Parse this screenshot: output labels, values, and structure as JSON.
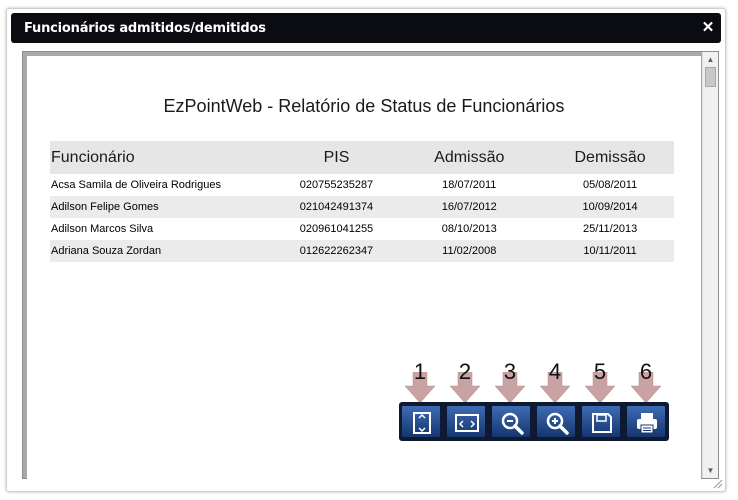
{
  "dialog": {
    "title": "Funcionários admitidos/demitidos",
    "close_glyph": "✕"
  },
  "report": {
    "title": "EzPointWeb - Relatório de Status de Funcionários",
    "columns": [
      "Funcionário",
      "PIS",
      "Admissão",
      "Demissão"
    ],
    "rows": [
      [
        "Acsa Samila de Oliveira Rodrigues",
        "020755235287",
        "18/07/2011",
        "05/08/2011"
      ],
      [
        "Adilson Felipe Gomes",
        "021042491374",
        "16/07/2012",
        "10/09/2014"
      ],
      [
        "Adilson Marcos Silva",
        "020961041255",
        "08/10/2013",
        "25/11/2013"
      ],
      [
        "Adriana Souza Zordan",
        "012622262347",
        "11/02/2008",
        "10/11/2011"
      ]
    ]
  },
  "callouts": [
    "1",
    "2",
    "3",
    "4",
    "5",
    "6"
  ],
  "toolbar": {
    "buttons": [
      {
        "icon": "fit-page-icon"
      },
      {
        "icon": "fit-width-icon"
      },
      {
        "icon": "zoom-out-icon"
      },
      {
        "icon": "zoom-in-icon"
      },
      {
        "icon": "save-icon"
      },
      {
        "icon": "print-icon"
      }
    ]
  },
  "colors": {
    "titlebar": "#0b0c12",
    "toolbar_button": "#2a5298",
    "callout_arrow": "#c9a3a3",
    "header_row": "#e6e6e6"
  }
}
